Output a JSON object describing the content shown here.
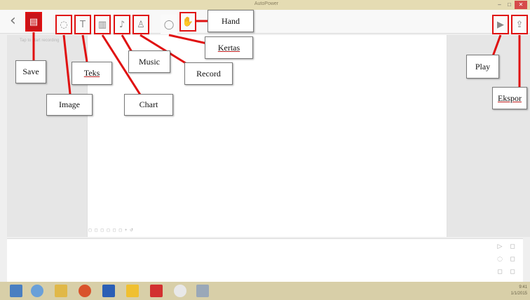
{
  "window": {
    "title": "AutoPower",
    "controls": {
      "minimize": "–",
      "maximize": "□",
      "close": "✕"
    }
  },
  "toolbar": {
    "back_icon": "chevron-left-icon",
    "back_glyph": "‹",
    "buttons": [
      {
        "id": "save",
        "icon": "save-icon",
        "glyph": "▤"
      },
      {
        "id": "image",
        "icon": "image-icon",
        "glyph": "◌"
      },
      {
        "id": "teks",
        "icon": "text-icon",
        "glyph": "T"
      },
      {
        "id": "chart",
        "icon": "chart-icon",
        "glyph": "▥"
      },
      {
        "id": "music",
        "icon": "music-icon",
        "glyph": "♪"
      },
      {
        "id": "record",
        "icon": "record-icon",
        "glyph": "♙"
      },
      {
        "id": "kertas",
        "icon": "paper-icon",
        "glyph": "◯"
      },
      {
        "id": "hand",
        "icon": "hand-icon",
        "glyph": "✋"
      },
      {
        "id": "play",
        "icon": "play-icon",
        "glyph": "▶"
      },
      {
        "id": "ekspor",
        "icon": "export-icon",
        "glyph": "⇪"
      }
    ]
  },
  "canvas": {
    "hint": "Tap to start recording",
    "bottom_bar": "◻ ◻ ◻ ◻ ◻ ◻ + ↺"
  },
  "timeline": {
    "controls": [
      "▷",
      "◻",
      "◌",
      "◻",
      "◻",
      "◻"
    ]
  },
  "taskbar": {
    "clock_time": "9:41",
    "clock_date": "1/1/2015"
  },
  "callouts": {
    "save": "Save",
    "image": "Image",
    "teks": "Teks",
    "chart": "Chart",
    "music": "Music",
    "record": "Record",
    "kertas": "Kertas",
    "hand": "Hand",
    "play": "Play",
    "ekspor": "Ekspor"
  },
  "colors": {
    "highlight": "#e01010",
    "save_button": "#c8141a",
    "taskbar": "#d8cfa8"
  }
}
